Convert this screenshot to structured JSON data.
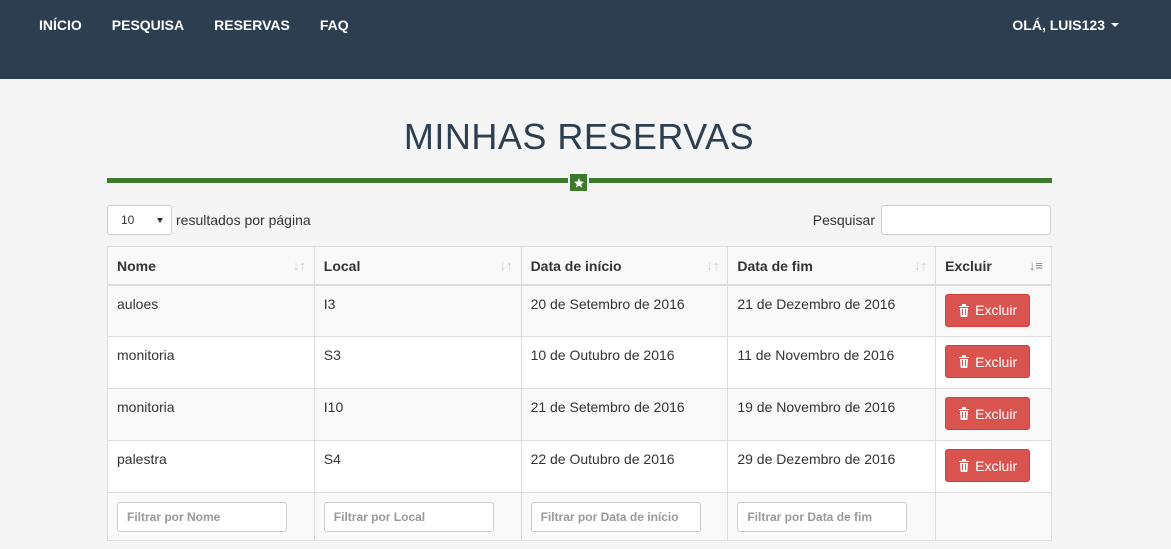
{
  "nav": {
    "links": [
      "Início",
      "Pesquisa",
      "Reservas",
      "FAQ"
    ],
    "user": "Olá, luis123"
  },
  "page_title": "MINHAS RESERVAS",
  "divider_icon": "star-icon",
  "length": {
    "value": "10",
    "label": "resultados por página"
  },
  "search": {
    "label": "Pesquisar",
    "value": ""
  },
  "table": {
    "headers": [
      "Nome",
      "Local",
      "Data de início",
      "Data de fim",
      "Excluir"
    ],
    "rows": [
      [
        "auloes",
        "I3",
        "20 de Setembro de 2016",
        "21 de Dezembro de 2016"
      ],
      [
        "monitoria",
        "S3",
        "10 de Outubro de 2016",
        "11 de Novembro de 2016"
      ],
      [
        "monitoria",
        "I10",
        "21 de Setembro de 2016",
        "19 de Novembro de 2016"
      ],
      [
        "palestra",
        "S4",
        "22 de Outubro de 2016",
        "29 de Dezembro de 2016"
      ]
    ],
    "delete_label": "Excluir",
    "filters": [
      "Filtrar por Nome",
      "Filtrar por Local",
      "Filtrar por Data de início",
      "Filtrar por Data de fim"
    ]
  },
  "colors": {
    "navbar": "#2c3e50",
    "accent": "#3c7a2c",
    "danger": "#d9534f"
  }
}
